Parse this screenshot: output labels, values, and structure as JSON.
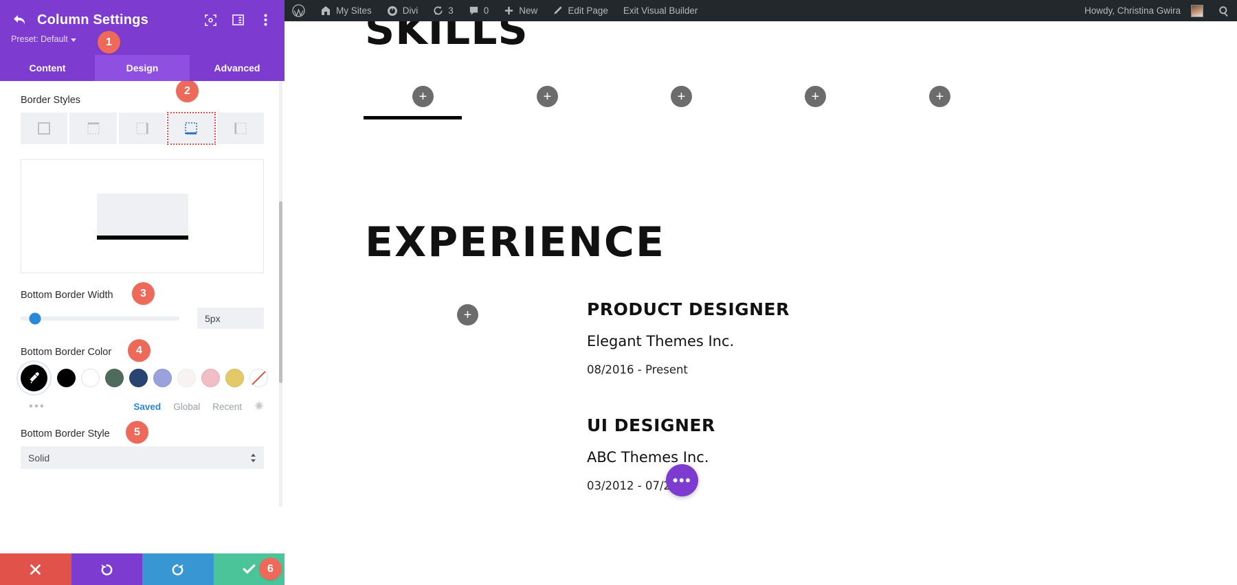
{
  "settings_panel": {
    "title": "Column Settings",
    "preset_label": "Preset: Default",
    "back_icon": "back-arrow-icon",
    "header_icons": [
      "fullscreen-icon",
      "layout-columns-icon",
      "kebab-menu-icon"
    ],
    "tabs": [
      {
        "label": "Content",
        "active": false
      },
      {
        "label": "Design",
        "active": true
      },
      {
        "label": "Advanced",
        "active": false
      }
    ],
    "border_styles": {
      "label": "Border Styles",
      "options": [
        {
          "name": "border-all-sides",
          "selected": false
        },
        {
          "name": "border-top-only",
          "selected": false
        },
        {
          "name": "border-right-only",
          "selected": false
        },
        {
          "name": "border-bottom-only",
          "selected": true
        },
        {
          "name": "border-left-only",
          "selected": false
        }
      ]
    },
    "bottom_border_width": {
      "label": "Bottom Border Width",
      "value": "5px",
      "slider_percent": 9
    },
    "bottom_border_color": {
      "label": "Bottom Border Color",
      "picker_icon": "eyedropper-icon",
      "swatches": [
        "#000000",
        "#ffffff",
        "#4e6b5e",
        "#274472",
        "#9aa1dc",
        "#f7f3f2",
        "#f0bec4",
        "#e4c969"
      ],
      "no_color_label": "none",
      "more_icon": "ellipsis-icon",
      "tabs": [
        {
          "label": "Saved",
          "active": true
        },
        {
          "label": "Global",
          "active": false
        },
        {
          "label": "Recent",
          "active": false
        }
      ],
      "settings_icon": "gear-icon"
    },
    "bottom_border_style": {
      "label": "Bottom Border Style",
      "value": "Solid"
    },
    "actions": [
      {
        "name": "cancel-button",
        "icon": "close-icon",
        "color": "#e0524a"
      },
      {
        "name": "undo-button",
        "icon": "undo-icon",
        "color": "#7E3BD0"
      },
      {
        "name": "redo-button",
        "icon": "redo-icon",
        "color": "#3897d3"
      },
      {
        "name": "save-button",
        "icon": "checkmark-icon",
        "color": "#4cc49a"
      }
    ]
  },
  "callouts": [
    {
      "number": "1"
    },
    {
      "number": "2"
    },
    {
      "number": "3"
    },
    {
      "number": "4"
    },
    {
      "number": "5"
    },
    {
      "number": "6"
    }
  ],
  "adminbar": {
    "items": [
      {
        "name": "wordpress-logo",
        "icon": "wordpress-icon",
        "label": ""
      },
      {
        "name": "my-sites",
        "icon": "sites-icon",
        "label": "My Sites"
      },
      {
        "name": "divi",
        "icon": "divi-icon",
        "label": "Divi"
      },
      {
        "name": "updates",
        "icon": "updates-icon",
        "label": "3"
      },
      {
        "name": "comments",
        "icon": "comment-icon",
        "label": "0"
      },
      {
        "name": "new",
        "icon": "plus-icon",
        "label": "New"
      },
      {
        "name": "edit-page",
        "icon": "pencil-icon",
        "label": "Edit Page"
      },
      {
        "name": "exit-visual-builder",
        "icon": "",
        "label": "Exit Visual Builder"
      }
    ],
    "howdy": "Howdy, Christina Gwira",
    "search_icon": "search-icon"
  },
  "canvas": {
    "skills_heading": "SKILLS",
    "experience_heading": "EXPERIENCE",
    "add_module_label": "+",
    "fab_label": "•••",
    "jobs": [
      {
        "title": "PRODUCT DESIGNER",
        "company": "Elegant Themes Inc.",
        "dates": "08/2016 - Present"
      },
      {
        "title": "UI DESIGNER",
        "company": "ABC Themes Inc.",
        "dates": "03/2012 - 07/2016"
      }
    ]
  }
}
